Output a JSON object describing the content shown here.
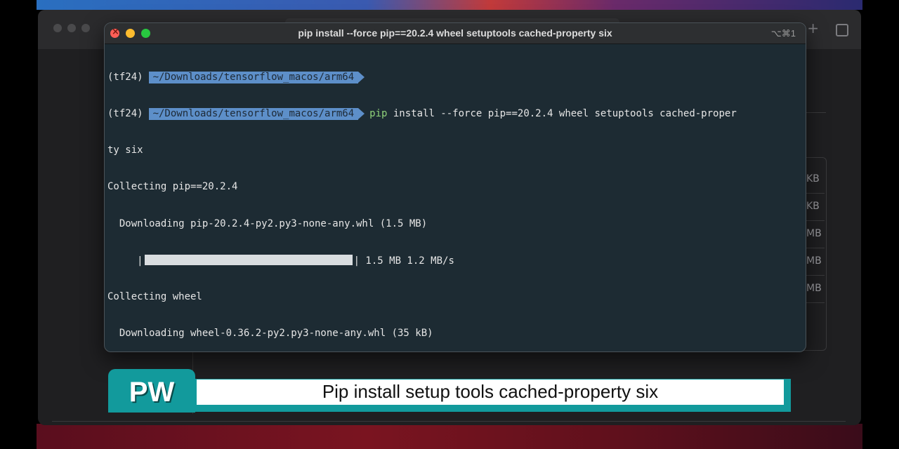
{
  "background_window": {
    "tab_plus": "+",
    "sizes": [
      "KB",
      "KB",
      "MB",
      "MB",
      "MB"
    ]
  },
  "terminal": {
    "title": "pip install --force pip==20.2.4 wheel setuptools cached-property six",
    "shortcut": "⌥⌘1",
    "lines": {
      "prompt1_env": "(tf24)",
      "prompt1_path": "~/Downloads/tensorflow_macos/arm64",
      "prompt2_env": "(tf24)",
      "prompt2_path": "~/Downloads/tensorflow_macos/arm64",
      "prompt2_cmd_pip": "pip",
      "prompt2_cmd_rest": " install --force pip==20.2.4 wheel setuptools cached-proper",
      "wrap": "ty six",
      "collect_pip": "Collecting pip==20.2.4",
      "download_pip": "  Downloading pip-20.2.4-py2.py3-none-any.whl (1.5 MB)",
      "progress_prefix": "     |",
      "progress_suffix": "| 1.5 MB 1.2 MB/s",
      "progress_fraction": 1.0,
      "collect_wheel": "Collecting wheel",
      "download_wheel": "  Downloading wheel-0.36.2-py2.py3-none-any.whl (35 kB)"
    }
  },
  "caption": {
    "logo": "PW",
    "text": "Pip install setup tools cached-property six"
  },
  "colors": {
    "terminal_bg": "#1d2b33",
    "path_segment": "#5d8fc9",
    "pip_command": "#8fd17a",
    "caption_teal": "#129a9c"
  }
}
